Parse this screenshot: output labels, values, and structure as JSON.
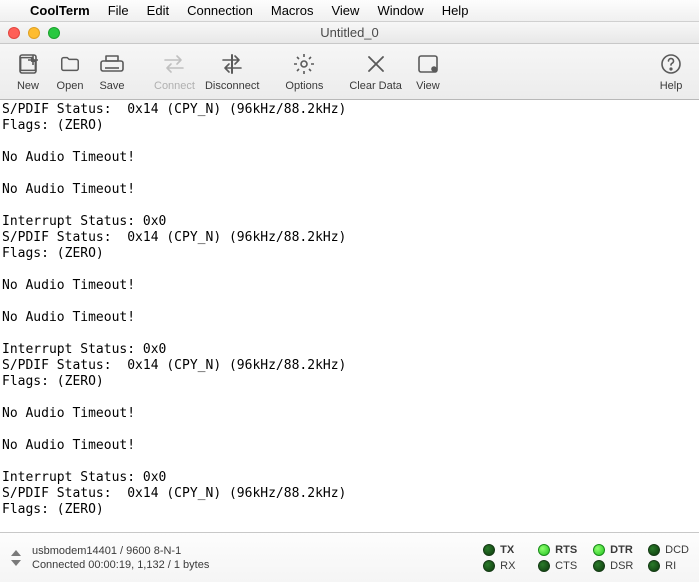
{
  "menubar": {
    "apple": "",
    "app": "CoolTerm",
    "items": [
      "File",
      "Edit",
      "Connection",
      "Macros",
      "View",
      "Window",
      "Help"
    ]
  },
  "window": {
    "title": "Untitled_0"
  },
  "toolbar": {
    "new": "New",
    "open": "Open",
    "save": "Save",
    "connect": "Connect",
    "disconnect": "Disconnect",
    "options": "Options",
    "clear": "Clear Data",
    "view": "View",
    "help": "Help"
  },
  "terminal": {
    "text": "S/PDIF Status:  0x14 (CPY_N) (96kHz/88.2kHz)\nFlags: (ZERO)\n\nNo Audio Timeout!\n\nNo Audio Timeout!\n\nInterrupt Status: 0x0\nS/PDIF Status:  0x14 (CPY_N) (96kHz/88.2kHz)\nFlags: (ZERO)\n\nNo Audio Timeout!\n\nNo Audio Timeout!\n\nInterrupt Status: 0x0\nS/PDIF Status:  0x14 (CPY_N) (96kHz/88.2kHz)\nFlags: (ZERO)\n\nNo Audio Timeout!\n\nNo Audio Timeout!\n\nInterrupt Status: 0x0\nS/PDIF Status:  0x14 (CPY_N) (96kHz/88.2kHz)\nFlags: (ZERO)\n"
  },
  "status": {
    "port": "usbmodem14401 / 9600 8-N-1",
    "connected": "Connected 00:00:19, 1,132 / 1 bytes",
    "leds": {
      "tx": {
        "label": "TX",
        "on": false,
        "bold": true
      },
      "rts": {
        "label": "RTS",
        "on": true,
        "bold": true
      },
      "dtr": {
        "label": "DTR",
        "on": true,
        "bold": true
      },
      "dcd": {
        "label": "DCD",
        "on": false,
        "bold": false
      },
      "rx": {
        "label": "RX",
        "on": false,
        "bold": false
      },
      "cts": {
        "label": "CTS",
        "on": false,
        "bold": false
      },
      "dsr": {
        "label": "DSR",
        "on": false,
        "bold": false
      },
      "ri": {
        "label": "RI",
        "on": false,
        "bold": false
      }
    }
  }
}
